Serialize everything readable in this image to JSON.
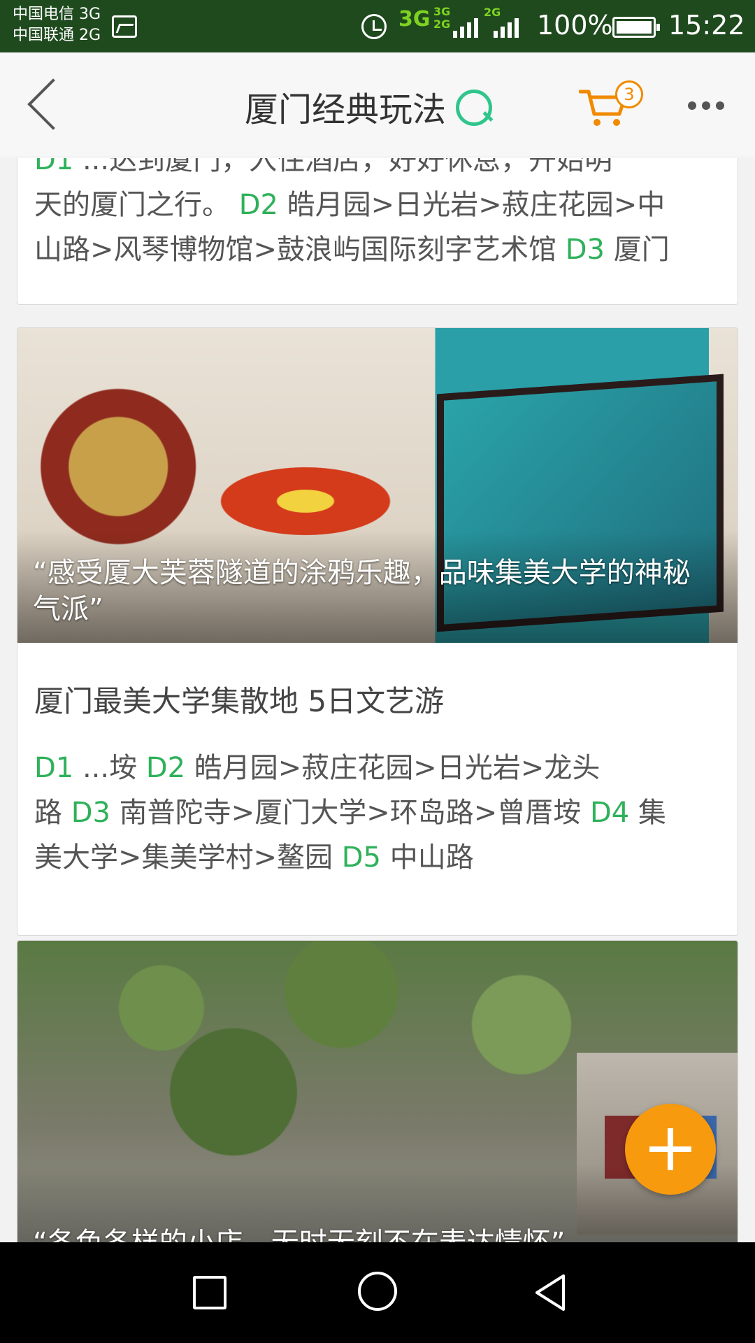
{
  "status_bar": {
    "carrier1": "中国电信 3G",
    "carrier2": "中国联通 2G",
    "net_main": "3G",
    "net_small_top": "3G",
    "net_small_bottom": "2G",
    "net_2g": "2G",
    "battery": "100%",
    "time": "15:22"
  },
  "header": {
    "title": "厦门经典玩法",
    "cart_count": "3"
  },
  "colors": {
    "accent_green": "#2fb15a",
    "search_green": "#2fc58b",
    "orange": "#f08a00",
    "status_bar_bg": "#1f4a1e"
  },
  "card1": {
    "lines": [
      [
        {
          "t": "D1",
          "g": true
        },
        {
          "t": " ...达到厦门，入住酒店，好好休息，开始明",
          "g": false
        }
      ],
      [
        {
          "t": "天的厦门之行。 ",
          "g": false
        },
        {
          "t": "D2",
          "g": true
        },
        {
          "t": " 皓月园>日光岩>菽庄花园>中",
          "g": false
        }
      ],
      [
        {
          "t": "山路>风琴博物馆>鼓浪屿国际刻字艺术馆 ",
          "g": false
        },
        {
          "t": "D3",
          "g": true
        },
        {
          "t": " 厦门",
          "g": false
        }
      ]
    ]
  },
  "card2": {
    "quote": "“感受厦大芙蓉隧道的涂鸦乐趣，品味集美大学的神秘气派”",
    "title": "厦门最美大学集散地 5日文艺游",
    "lines": [
      [
        {
          "t": " D1",
          "g": true
        },
        {
          "t": " ...垵 ",
          "g": false
        },
        {
          "t": "D2",
          "g": true
        },
        {
          "t": " 皓月园>菽庄花园>日光岩>龙头",
          "g": false
        }
      ],
      [
        {
          "t": "路 ",
          "g": false
        },
        {
          "t": "D3",
          "g": true
        },
        {
          "t": " 南普陀寺>厦门大学>环岛路>曾厝垵 ",
          "g": false
        },
        {
          "t": "D4",
          "g": true
        },
        {
          "t": " 集",
          "g": false
        }
      ],
      [
        {
          "t": "美大学>集美学村>鳌园 ",
          "g": false
        },
        {
          "t": "D5",
          "g": true
        },
        {
          "t": " 中山路",
          "g": false
        }
      ]
    ]
  },
  "card3": {
    "quote": "“各色各样的小店，无时无刻不在表达情怀”"
  }
}
